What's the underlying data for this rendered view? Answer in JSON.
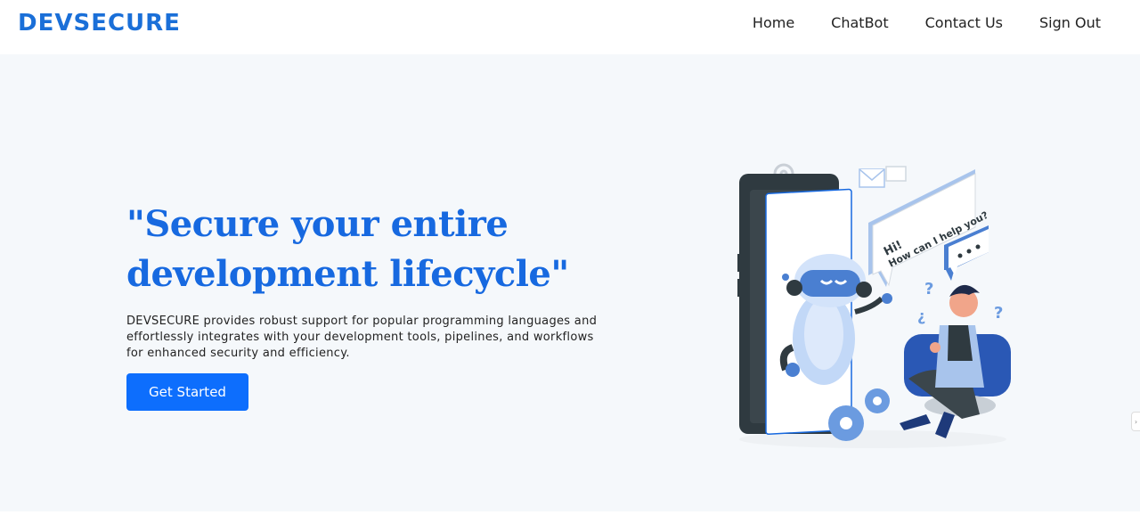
{
  "brand": {
    "name": "DEVSECURE",
    "accent": "#1a6fd8"
  },
  "nav": {
    "items": [
      "Home",
      "ChatBot",
      "Contact Us",
      "Sign Out"
    ]
  },
  "hero": {
    "title_line1": "\"Secure your entire",
    "title_line2": "development lifecycle\"",
    "description": "DEVSECURE provides robust support for popular programming languages and effortlessly integrates with your development tools, pipelines, and workflows for enhanced security and efficiency.",
    "cta_label": "Get Started",
    "cta_color": "#0d6efd"
  },
  "illustration": {
    "bubble_line1": "Hi!",
    "bubble_line2": "How can I help you?",
    "icons": [
      "robot-icon",
      "phone-icon",
      "person-icon",
      "gear-icon",
      "envelope-icon",
      "chat-bubble-icon",
      "question-mark-icon"
    ]
  }
}
